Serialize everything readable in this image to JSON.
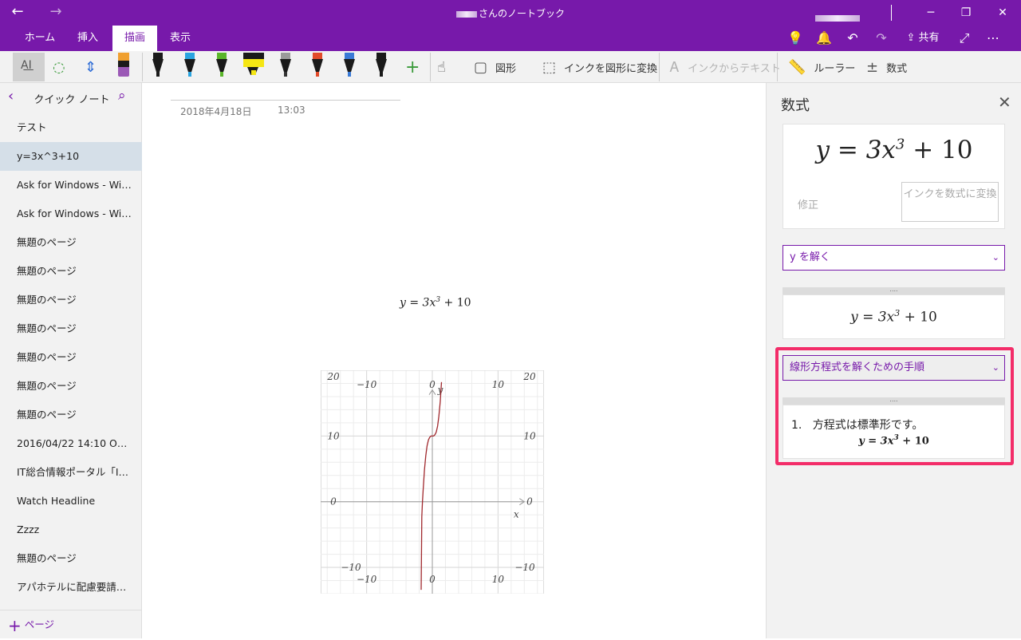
{
  "window": {
    "title": "さんのノートブック",
    "back_icon": "arrow-left-icon",
    "forward_icon": "arrow-right-icon",
    "controls": [
      "minimize-icon",
      "restore-icon",
      "close-icon"
    ]
  },
  "ribbon": {
    "tabs": [
      {
        "label": "ホーム"
      },
      {
        "label": "挿入"
      },
      {
        "label": "描画",
        "active": true
      },
      {
        "label": "表示"
      }
    ],
    "share_label": "共有",
    "icons": [
      "lightbulb-icon",
      "bell-icon",
      "undo-icon",
      "redo-icon",
      "share-icon",
      "expand-icon",
      "more-icon"
    ]
  },
  "toolbar": {
    "shapes_label": "図形",
    "ink_to_shape_label": "インクを図形に変換",
    "ink_to_text_label": "インクからテキスト",
    "ruler_label": "ルーラー",
    "math_label": "数式",
    "pens": [
      {
        "cap": "#1a1a1a",
        "tip": "#1a1a1a"
      },
      {
        "cap": "#2aa4e0",
        "tip": "#2aa4e0"
      },
      {
        "cap": "#5ab52a",
        "tip": "#5ab52a"
      },
      {
        "cap": "#f5e614",
        "tip": "#f5e614",
        "highlighter": true
      },
      {
        "cap": "#9a9a9a",
        "tip": "#333"
      },
      {
        "cap": "#e24b2a",
        "tip": "#e24b2a"
      },
      {
        "cap": "#3a7ad6",
        "tip": "#3a7ad6"
      },
      {
        "cap": "#1a1a1a",
        "tip": "#1a1a1a"
      }
    ],
    "active_pen": {
      "cap": "#f0a030",
      "body": "#9b59b6"
    },
    "accent": "#7719aa"
  },
  "sidebar": {
    "section_name": "クイック ノート",
    "pages": [
      {
        "label": "テスト"
      },
      {
        "label": "y=3x^3+10",
        "selected": true
      },
      {
        "label": "Ask for Windows - Win..."
      },
      {
        "label": "Ask for Windows - Win..."
      },
      {
        "label": "無題のページ"
      },
      {
        "label": "無題のページ"
      },
      {
        "label": "無題のページ"
      },
      {
        "label": "無題のページ"
      },
      {
        "label": "無題のページ"
      },
      {
        "label": "無題のページ"
      },
      {
        "label": "無題のページ"
      },
      {
        "label": "2016/04/22 14:10 Offic..."
      },
      {
        "label": "IT総合情報ポータル「ITm..."
      },
      {
        "label": "Watch Headline"
      },
      {
        "label": "Zzzz"
      },
      {
        "label": "無題のページ"
      },
      {
        "label": "アパホテルに配慮要請＝..."
      }
    ],
    "add_page_label": "ページ"
  },
  "note": {
    "date": "2018年4月18日",
    "time": "13:03",
    "equation": "y = 3x",
    "equation_exp": "3",
    "equation_rest": " + 10"
  },
  "chart_data": {
    "type": "line",
    "function": "y = 3x^3 + 10",
    "series": [
      {
        "values": [
          [
            -1.7,
            -14.7
          ],
          [
            -1.6,
            -2.3
          ],
          [
            -1.5,
            -0.1
          ],
          [
            -1.4,
            1.8
          ],
          [
            -1.2,
            4.8
          ],
          [
            -1.0,
            7
          ],
          [
            -0.8,
            8.5
          ],
          [
            -0.6,
            9.4
          ],
          [
            -0.4,
            9.8
          ],
          [
            -0.2,
            10
          ],
          [
            0,
            10
          ],
          [
            0.2,
            10
          ],
          [
            0.4,
            10.2
          ],
          [
            0.6,
            10.6
          ],
          [
            0.8,
            11.5
          ],
          [
            1.0,
            13
          ],
          [
            1.2,
            15.2
          ],
          [
            1.4,
            18.2
          ],
          [
            1.5,
            20.1
          ],
          [
            1.6,
            22.3
          ]
        ]
      }
    ],
    "xlabel": "x",
    "ylabel": "y",
    "xlim": [
      -17,
      17
    ],
    "ylim": [
      -14,
      20
    ],
    "x_ticks": [
      "−10",
      "0",
      "10"
    ],
    "y_ticks": [
      "20",
      "10",
      "0",
      "−10"
    ],
    "grid": true,
    "line_color": "#a0282d"
  },
  "math_panel": {
    "title": "数式",
    "equation": "y = 3x",
    "equation_exp": "3",
    "equation_rest": " + 10",
    "fix_label": "修正",
    "convert_label": "インクを数式に変換",
    "solve_dropdown": "y を解く",
    "solve_result": "y = 3x",
    "steps_dropdown": "線形方程式を解くための手順",
    "step_number": "1.",
    "step_text": "方程式は標準形です。",
    "step_equation": "y = 3x",
    "grip": "....",
    "highlight_color": "#f32d69"
  }
}
